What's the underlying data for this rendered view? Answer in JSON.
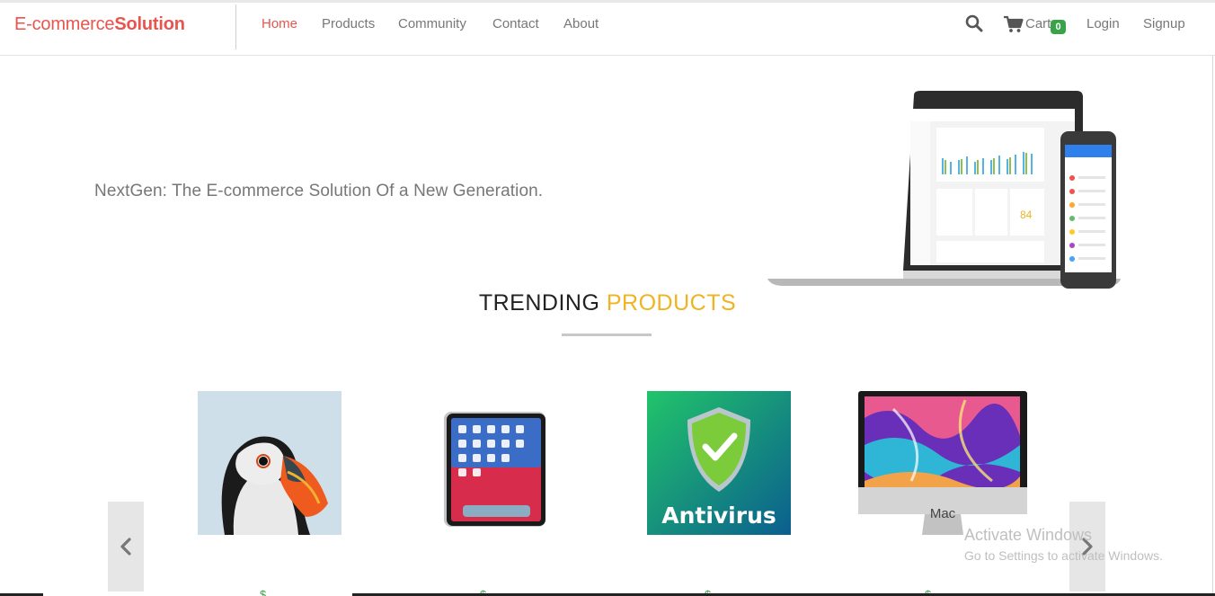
{
  "brand": {
    "part1": "E-commerce",
    "part2": "Solution"
  },
  "nav": {
    "links": [
      "Home",
      "Products",
      "Community",
      "Contact",
      "About"
    ],
    "active": "Home",
    "cart_label": "Cart",
    "cart_count": "0",
    "login": "Login",
    "signup": "Signup",
    "icons": [
      "search-icon",
      "cart-icon"
    ]
  },
  "hero": {
    "tagline": "NextGen: The E-commerce Solution Of a New Generation.",
    "chart_badge": "84"
  },
  "trending": {
    "title_part1": "TRENDING",
    "title_part2": "PRODUCTS"
  },
  "products": [
    {
      "image": "puffin-photo",
      "label": ""
    },
    {
      "image": "ipad-photo",
      "label": ""
    },
    {
      "image": "antivirus-box",
      "label": "Antivirus"
    },
    {
      "image": "imac-photo",
      "label": "Mac"
    }
  ],
  "prices": [
    "$…",
    "$…",
    "$…",
    "$…"
  ],
  "watermark": {
    "line1": "Activate Windows",
    "line2": "Go to Settings to activate Windows."
  },
  "colors": {
    "brand": "#e8554e",
    "accent": "#f0b321",
    "badge": "#3aa34a"
  }
}
